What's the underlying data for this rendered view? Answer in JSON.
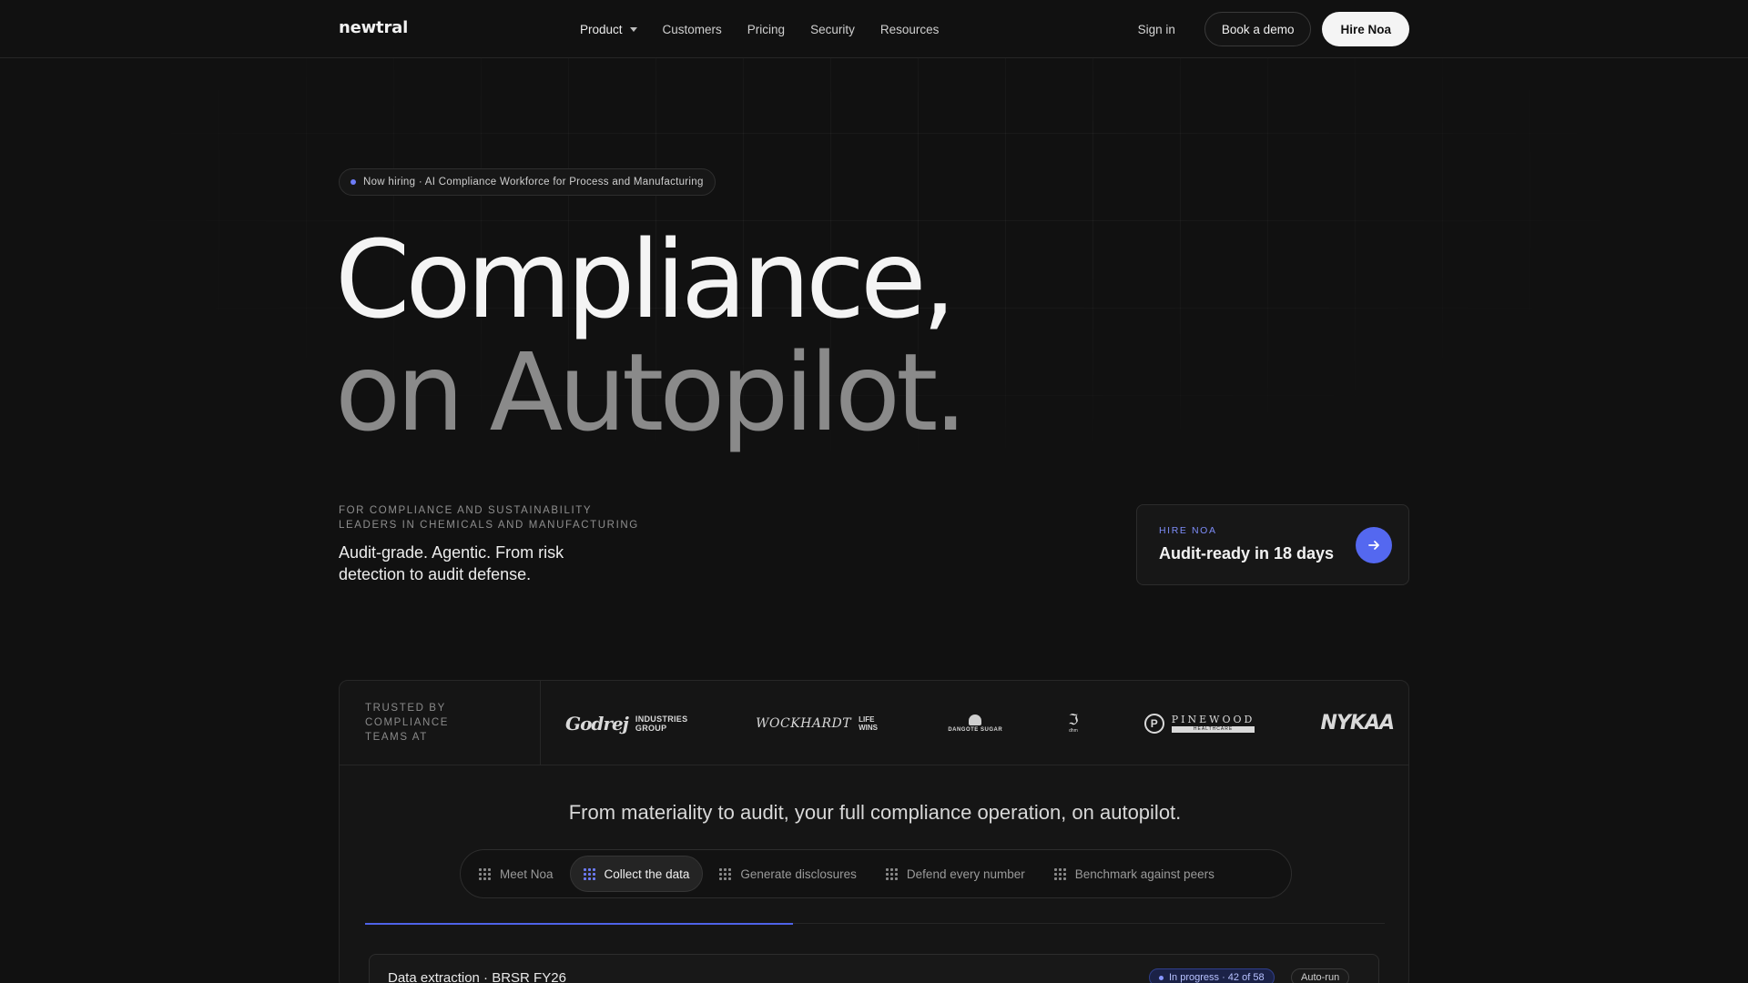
{
  "brand": {
    "name": "newtral"
  },
  "nav": {
    "links": [
      "Product",
      "Customers",
      "Pricing",
      "Security",
      "Resources"
    ],
    "sign_in": "Sign in",
    "book_demo": "Book a demo",
    "hire": "Hire Noa"
  },
  "hero": {
    "pill": "Now hiring · AI Compliance Workforce for Process and Manufacturing",
    "title_line1": "Compliance,",
    "title_line2": "on Autopilot.",
    "eyebrow": "For compliance and sustainability leaders in chemicals and manufacturing",
    "subtitle": "Audit-grade. Agentic. From risk detection to audit defense."
  },
  "hire_card": {
    "eyebrow": "HIRE NOA",
    "title": "Audit-ready in 18 days",
    "icon": "arrow-right-icon"
  },
  "trust": {
    "label": "Trusted by compliance teams at",
    "logos": {
      "godrej_script": "Godrej",
      "godrej_text": "INDUSTRIES GROUP",
      "wockhardt_script": "WOCKHARDT",
      "wockhardt_text": "LIFE WINS",
      "dangote": "DANGOTE SUGAR",
      "dhm": "dhm",
      "pinewood": "PINEWOOD",
      "pinewood_sub": "HEALTHCARE",
      "nykaa": "NYKAA"
    }
  },
  "workflow": {
    "tagline": "From materiality to audit, your full compliance operation, on autopilot.",
    "tabs": [
      "Meet Noa",
      "Collect the data",
      "Generate disclosures",
      "Defend every number",
      "Benchmark against peers"
    ],
    "active_tab": 1,
    "progress_fraction": 0.42
  },
  "task_card": {
    "title": "Data extraction · BRSR FY26",
    "status": "In progress · 42 of 58",
    "mode": "Auto-run"
  },
  "colors": {
    "background": "#111111",
    "accent": "#5468f0",
    "accent_text": "#7d8cf8"
  }
}
